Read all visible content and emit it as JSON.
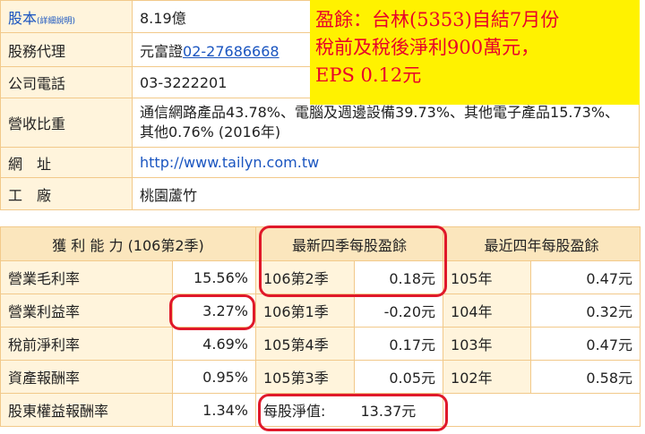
{
  "info": {
    "capital_label": "股本",
    "capital_detail": "(詳細說明)",
    "capital_value": "8.19億",
    "agent_label": "股務代理",
    "agent_name": "元富證",
    "agent_phone": "02-27686668",
    "phone_label": "公司電話",
    "phone_value": "03-3222201",
    "revenue_label": "營收比重",
    "revenue_value": "通信網路產品43.78%、電腦及週邊設備39.73%、其他電子產品15.73%、其他0.76% (2016年)",
    "website_label": "網　址",
    "website_value": "http://www.tailyn.com.tw",
    "factory_label": "工　廠",
    "factory_value": "桃園蘆竹"
  },
  "overlay": {
    "line1": "盈餘：台林(5353)自結7月份",
    "line2": "稅前及稅後淨利900萬元，",
    "line3": "EPS 0.12元"
  },
  "stats": {
    "header_profit": "獲 利 能 力 (106第2季)",
    "header_quarter": "最新四季每股盈餘",
    "header_year": "最近四年每股盈餘",
    "rows": [
      {
        "label": "營業毛利率",
        "value": "15.56%",
        "q_label": "106第2季",
        "q_value": "0.18元",
        "y_label": "105年",
        "y_value": "0.47元"
      },
      {
        "label": "營業利益率",
        "value": "3.27%",
        "q_label": "106第1季",
        "q_value": "-0.20元",
        "y_label": "104年",
        "y_value": "0.32元"
      },
      {
        "label": "稅前淨利率",
        "value": "4.69%",
        "q_label": "105第4季",
        "q_value": "0.17元",
        "y_label": "103年",
        "y_value": "0.47元"
      },
      {
        "label": "資產報酬率",
        "value": "0.95%",
        "q_label": "105第3季",
        "q_value": "0.05元",
        "y_label": "102年",
        "y_value": "0.58元"
      }
    ],
    "last_label": "股東權益報酬率",
    "last_value": "1.34%",
    "nav_label": "每股淨值:",
    "nav_value": "13.37元"
  }
}
